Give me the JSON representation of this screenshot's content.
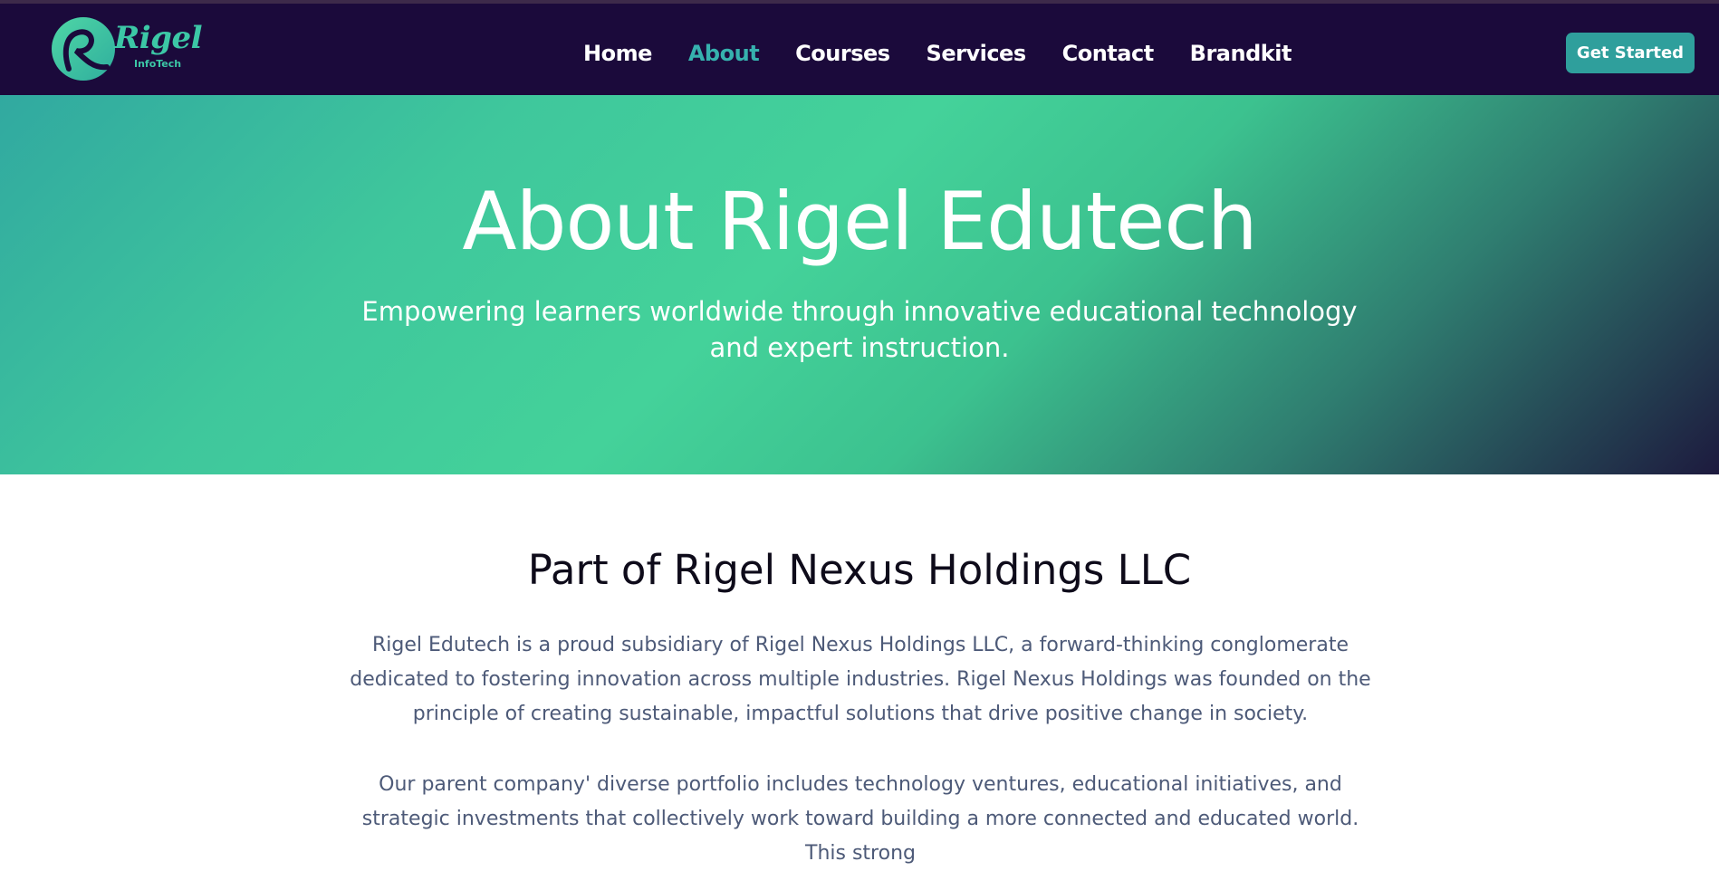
{
  "brand": {
    "name": "Rigel",
    "tagline": "InfoTech",
    "color": "#3cc7a6"
  },
  "nav": {
    "items": [
      {
        "label": "Home",
        "active": false
      },
      {
        "label": "About",
        "active": true
      },
      {
        "label": "Courses",
        "active": false
      },
      {
        "label": "Services",
        "active": false
      },
      {
        "label": "Contact",
        "active": false
      },
      {
        "label": "Brandkit",
        "active": false
      }
    ],
    "active_color": "#36b1ae"
  },
  "header": {
    "cta_label": "Get Started",
    "background": "#1b0a3b"
  },
  "hero": {
    "title": "About Rigel Edutech",
    "subtitle": "Empowering learners worldwide through innovative educational technology and expert instruction."
  },
  "main": {
    "section_title": "Part of Rigel Nexus Holdings LLC",
    "paragraphs": [
      "Rigel Edutech is a proud subsidiary of Rigel Nexus Holdings LLC, a forward-thinking conglomerate dedicated to fostering innovation across multiple industries. Rigel Nexus Holdings was founded on the principle of creating sustainable, impactful solutions that drive positive change in society.",
      "Our parent company' diverse portfolio includes technology ventures, educational initiatives, and strategic investments that collectively work toward building a more connected and educated world. This strong"
    ]
  }
}
